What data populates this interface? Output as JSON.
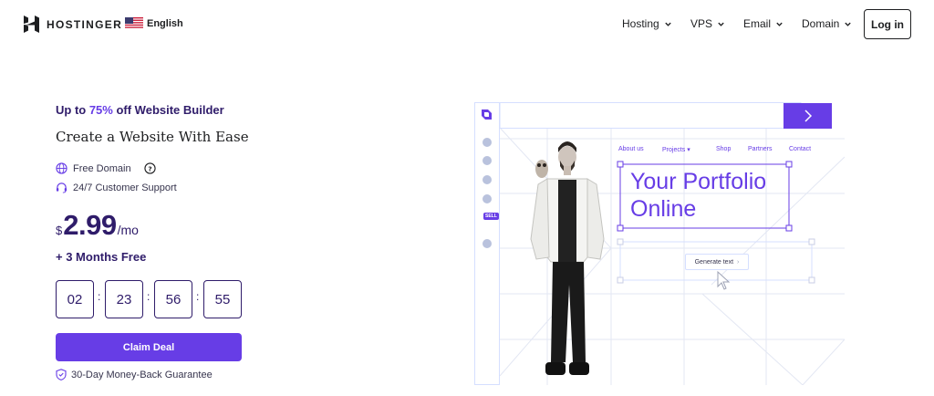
{
  "header": {
    "brand": "HOSTINGER",
    "language": "English",
    "nav": [
      {
        "label": "Hosting"
      },
      {
        "label": "VPS"
      },
      {
        "label": "Email"
      },
      {
        "label": "Domain"
      }
    ],
    "login_label": "Log in"
  },
  "promo": {
    "prefix": "Up to ",
    "discount": "75%",
    "suffix": " off Website Builder",
    "subtitle": "Create a Website With Ease",
    "features": [
      "Free Domain",
      "24/7 Customer Support"
    ],
    "currency": "$",
    "price": "2.99",
    "period": "/mo",
    "bonus": "+ 3 Months Free",
    "countdown": [
      "02",
      "23",
      "56",
      "55"
    ],
    "cta_label": "Claim Deal",
    "guarantee": "30-Day Money-Back Guarantee"
  },
  "illustration": {
    "menu": [
      "About us",
      "Projects ▾",
      "Shop",
      "Partners",
      "Contact"
    ],
    "headline_line1": "Your Portfolio",
    "headline_line2": "Online",
    "generate_label": "Generate text",
    "sidebar_tag": "SELL"
  },
  "colors": {
    "accent": "#673de6",
    "text_dark": "#2f1c6a",
    "border": "#1d1e20"
  }
}
